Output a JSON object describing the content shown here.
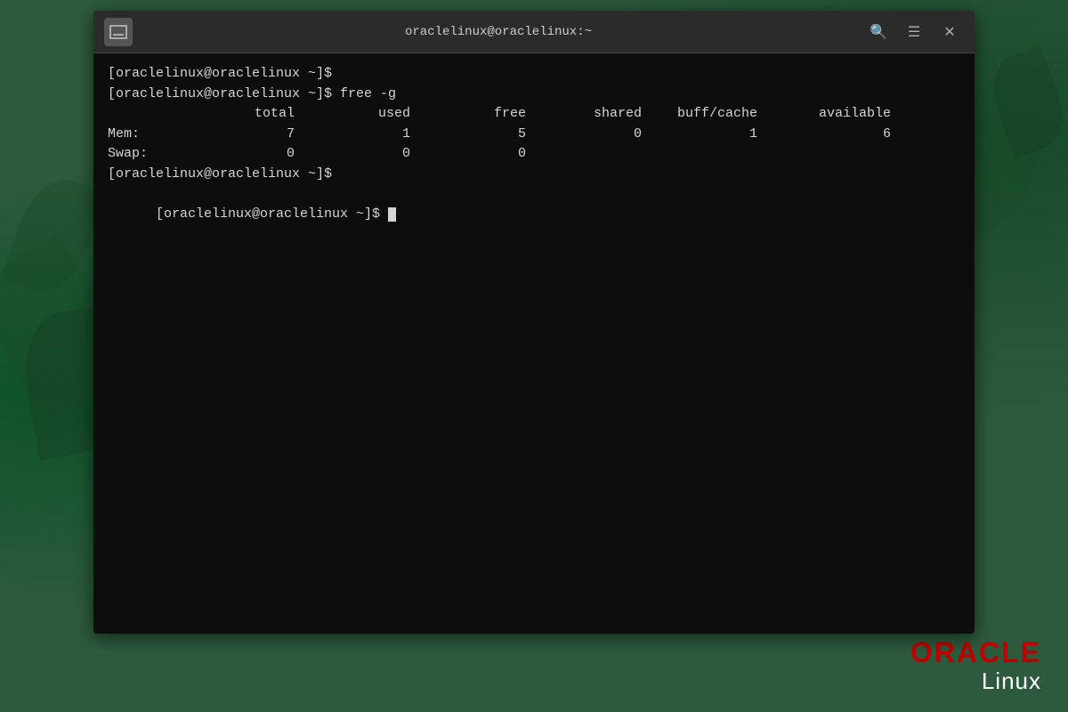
{
  "desktop": {
    "background_color": "#2d5a3d"
  },
  "titlebar": {
    "title": "oraclelinux@oraclelinux:~",
    "search_icon": "🔍",
    "menu_icon": "☰",
    "close_icon": "✕"
  },
  "terminal": {
    "lines": [
      {
        "type": "prompt",
        "text": "[oraclelinux@oraclelinux ~]$"
      },
      {
        "type": "command",
        "text": "[oraclelinux@oraclelinux ~]$ free -g"
      },
      {
        "type": "header",
        "cols": [
          "",
          "total",
          "used",
          "free",
          "shared",
          "buff/cache",
          "available"
        ]
      },
      {
        "type": "data_mem",
        "label": "Mem:",
        "total": "7",
        "used": "1",
        "free": "5",
        "shared": "0",
        "buff": "1",
        "available": "6"
      },
      {
        "type": "data_swap",
        "label": "Swap:",
        "total": "0",
        "used": "0",
        "free": "0",
        "shared": "",
        "buff": "",
        "available": ""
      },
      {
        "type": "prompt_empty",
        "text": "[oraclelinux@oraclelinux ~]$"
      },
      {
        "type": "prompt_cursor",
        "text": "[oraclelinux@oraclelinux ~]$ "
      }
    ]
  },
  "branding": {
    "oracle": "ORACLE",
    "linux": "Linux"
  }
}
